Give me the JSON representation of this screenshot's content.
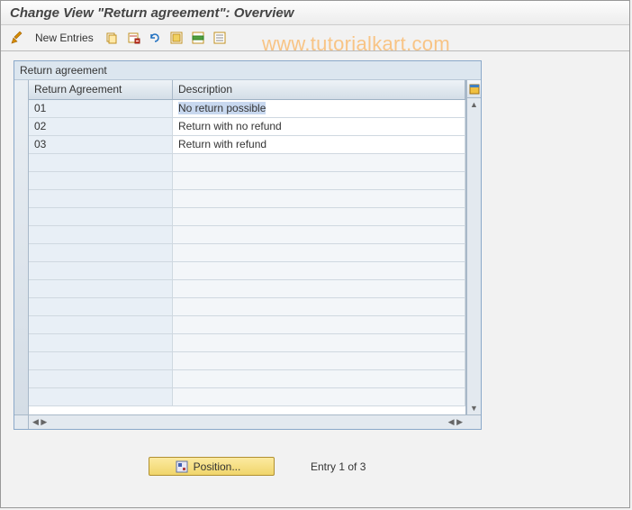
{
  "title": "Change View \"Return agreement\": Overview",
  "toolbar": {
    "new_entries_label": "New Entries"
  },
  "watermark": "www.tutorialkart.com",
  "panel": {
    "title": "Return agreement",
    "columns": [
      "Return Agreement",
      "Description"
    ]
  },
  "rows": [
    {
      "code": "01",
      "desc": "No return possible",
      "selected": true
    },
    {
      "code": "02",
      "desc": "Return with no refund",
      "selected": false
    },
    {
      "code": "03",
      "desc": "Return with refund",
      "selected": false
    }
  ],
  "footer": {
    "position_label": "Position...",
    "entry_text": "Entry 1 of 3"
  }
}
